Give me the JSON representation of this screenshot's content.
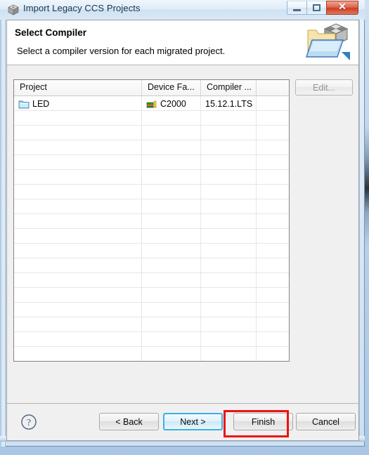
{
  "window": {
    "title": "Import Legacy CCS Projects",
    "icon": "cube-icon",
    "controls": {
      "minimize": "minimize-icon",
      "maximize": "maximize-icon",
      "close": "close-icon",
      "close_glyph": "✕"
    }
  },
  "banner": {
    "title": "Select Compiler",
    "subtitle": "Select a compiler version for each migrated project.",
    "icon": "import-projects-folder-icon"
  },
  "table": {
    "columns": [
      {
        "label": "Project"
      },
      {
        "label": "Device Fa..."
      },
      {
        "label": "Compiler ..."
      },
      {
        "label": ""
      }
    ],
    "rows": [
      {
        "project": "LED",
        "project_icon": "folder-icon",
        "device_family": "C2000",
        "device_icon": "device-chip-icon",
        "compiler_version": "15.12.1.LTS",
        "extra": ""
      }
    ],
    "empty_row_count": 17
  },
  "side_actions": {
    "edit_label": "Edit...",
    "edit_enabled": false
  },
  "buttonbar": {
    "help_icon": "help-question-icon",
    "help_glyph": "?",
    "back_label": "< Back",
    "next_label": "Next >",
    "finish_label": "Finish",
    "cancel_label": "Cancel",
    "focused_button": "Next >",
    "highlighted_button": "Finish"
  },
  "colors": {
    "highlight_annotation": "#ee1111",
    "focus_border": "#3cb0e5",
    "titlebar_text": "#16334d",
    "close_button": "#c83f22",
    "disabled_text": "#949494"
  }
}
